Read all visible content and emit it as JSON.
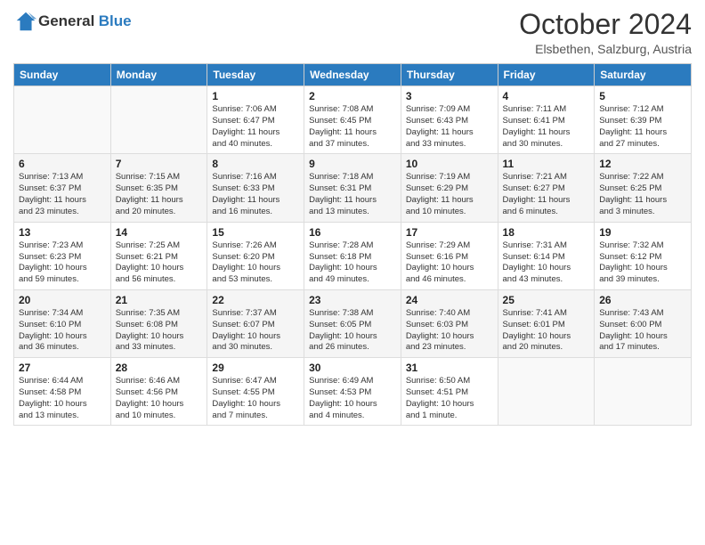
{
  "header": {
    "logo_general": "General",
    "logo_blue": "Blue",
    "title": "October 2024",
    "subtitle": "Elsbethen, Salzburg, Austria"
  },
  "weekdays": [
    "Sunday",
    "Monday",
    "Tuesday",
    "Wednesday",
    "Thursday",
    "Friday",
    "Saturday"
  ],
  "weeks": [
    [
      {
        "day": "",
        "info": ""
      },
      {
        "day": "",
        "info": ""
      },
      {
        "day": "1",
        "info": "Sunrise: 7:06 AM\nSunset: 6:47 PM\nDaylight: 11 hours\nand 40 minutes."
      },
      {
        "day": "2",
        "info": "Sunrise: 7:08 AM\nSunset: 6:45 PM\nDaylight: 11 hours\nand 37 minutes."
      },
      {
        "day": "3",
        "info": "Sunrise: 7:09 AM\nSunset: 6:43 PM\nDaylight: 11 hours\nand 33 minutes."
      },
      {
        "day": "4",
        "info": "Sunrise: 7:11 AM\nSunset: 6:41 PM\nDaylight: 11 hours\nand 30 minutes."
      },
      {
        "day": "5",
        "info": "Sunrise: 7:12 AM\nSunset: 6:39 PM\nDaylight: 11 hours\nand 27 minutes."
      }
    ],
    [
      {
        "day": "6",
        "info": "Sunrise: 7:13 AM\nSunset: 6:37 PM\nDaylight: 11 hours\nand 23 minutes."
      },
      {
        "day": "7",
        "info": "Sunrise: 7:15 AM\nSunset: 6:35 PM\nDaylight: 11 hours\nand 20 minutes."
      },
      {
        "day": "8",
        "info": "Sunrise: 7:16 AM\nSunset: 6:33 PM\nDaylight: 11 hours\nand 16 minutes."
      },
      {
        "day": "9",
        "info": "Sunrise: 7:18 AM\nSunset: 6:31 PM\nDaylight: 11 hours\nand 13 minutes."
      },
      {
        "day": "10",
        "info": "Sunrise: 7:19 AM\nSunset: 6:29 PM\nDaylight: 11 hours\nand 10 minutes."
      },
      {
        "day": "11",
        "info": "Sunrise: 7:21 AM\nSunset: 6:27 PM\nDaylight: 11 hours\nand 6 minutes."
      },
      {
        "day": "12",
        "info": "Sunrise: 7:22 AM\nSunset: 6:25 PM\nDaylight: 11 hours\nand 3 minutes."
      }
    ],
    [
      {
        "day": "13",
        "info": "Sunrise: 7:23 AM\nSunset: 6:23 PM\nDaylight: 10 hours\nand 59 minutes."
      },
      {
        "day": "14",
        "info": "Sunrise: 7:25 AM\nSunset: 6:21 PM\nDaylight: 10 hours\nand 56 minutes."
      },
      {
        "day": "15",
        "info": "Sunrise: 7:26 AM\nSunset: 6:20 PM\nDaylight: 10 hours\nand 53 minutes."
      },
      {
        "day": "16",
        "info": "Sunrise: 7:28 AM\nSunset: 6:18 PM\nDaylight: 10 hours\nand 49 minutes."
      },
      {
        "day": "17",
        "info": "Sunrise: 7:29 AM\nSunset: 6:16 PM\nDaylight: 10 hours\nand 46 minutes."
      },
      {
        "day": "18",
        "info": "Sunrise: 7:31 AM\nSunset: 6:14 PM\nDaylight: 10 hours\nand 43 minutes."
      },
      {
        "day": "19",
        "info": "Sunrise: 7:32 AM\nSunset: 6:12 PM\nDaylight: 10 hours\nand 39 minutes."
      }
    ],
    [
      {
        "day": "20",
        "info": "Sunrise: 7:34 AM\nSunset: 6:10 PM\nDaylight: 10 hours\nand 36 minutes."
      },
      {
        "day": "21",
        "info": "Sunrise: 7:35 AM\nSunset: 6:08 PM\nDaylight: 10 hours\nand 33 minutes."
      },
      {
        "day": "22",
        "info": "Sunrise: 7:37 AM\nSunset: 6:07 PM\nDaylight: 10 hours\nand 30 minutes."
      },
      {
        "day": "23",
        "info": "Sunrise: 7:38 AM\nSunset: 6:05 PM\nDaylight: 10 hours\nand 26 minutes."
      },
      {
        "day": "24",
        "info": "Sunrise: 7:40 AM\nSunset: 6:03 PM\nDaylight: 10 hours\nand 23 minutes."
      },
      {
        "day": "25",
        "info": "Sunrise: 7:41 AM\nSunset: 6:01 PM\nDaylight: 10 hours\nand 20 minutes."
      },
      {
        "day": "26",
        "info": "Sunrise: 7:43 AM\nSunset: 6:00 PM\nDaylight: 10 hours\nand 17 minutes."
      }
    ],
    [
      {
        "day": "27",
        "info": "Sunrise: 6:44 AM\nSunset: 4:58 PM\nDaylight: 10 hours\nand 13 minutes."
      },
      {
        "day": "28",
        "info": "Sunrise: 6:46 AM\nSunset: 4:56 PM\nDaylight: 10 hours\nand 10 minutes."
      },
      {
        "day": "29",
        "info": "Sunrise: 6:47 AM\nSunset: 4:55 PM\nDaylight: 10 hours\nand 7 minutes."
      },
      {
        "day": "30",
        "info": "Sunrise: 6:49 AM\nSunset: 4:53 PM\nDaylight: 10 hours\nand 4 minutes."
      },
      {
        "day": "31",
        "info": "Sunrise: 6:50 AM\nSunset: 4:51 PM\nDaylight: 10 hours\nand 1 minute."
      },
      {
        "day": "",
        "info": ""
      },
      {
        "day": "",
        "info": ""
      }
    ]
  ]
}
